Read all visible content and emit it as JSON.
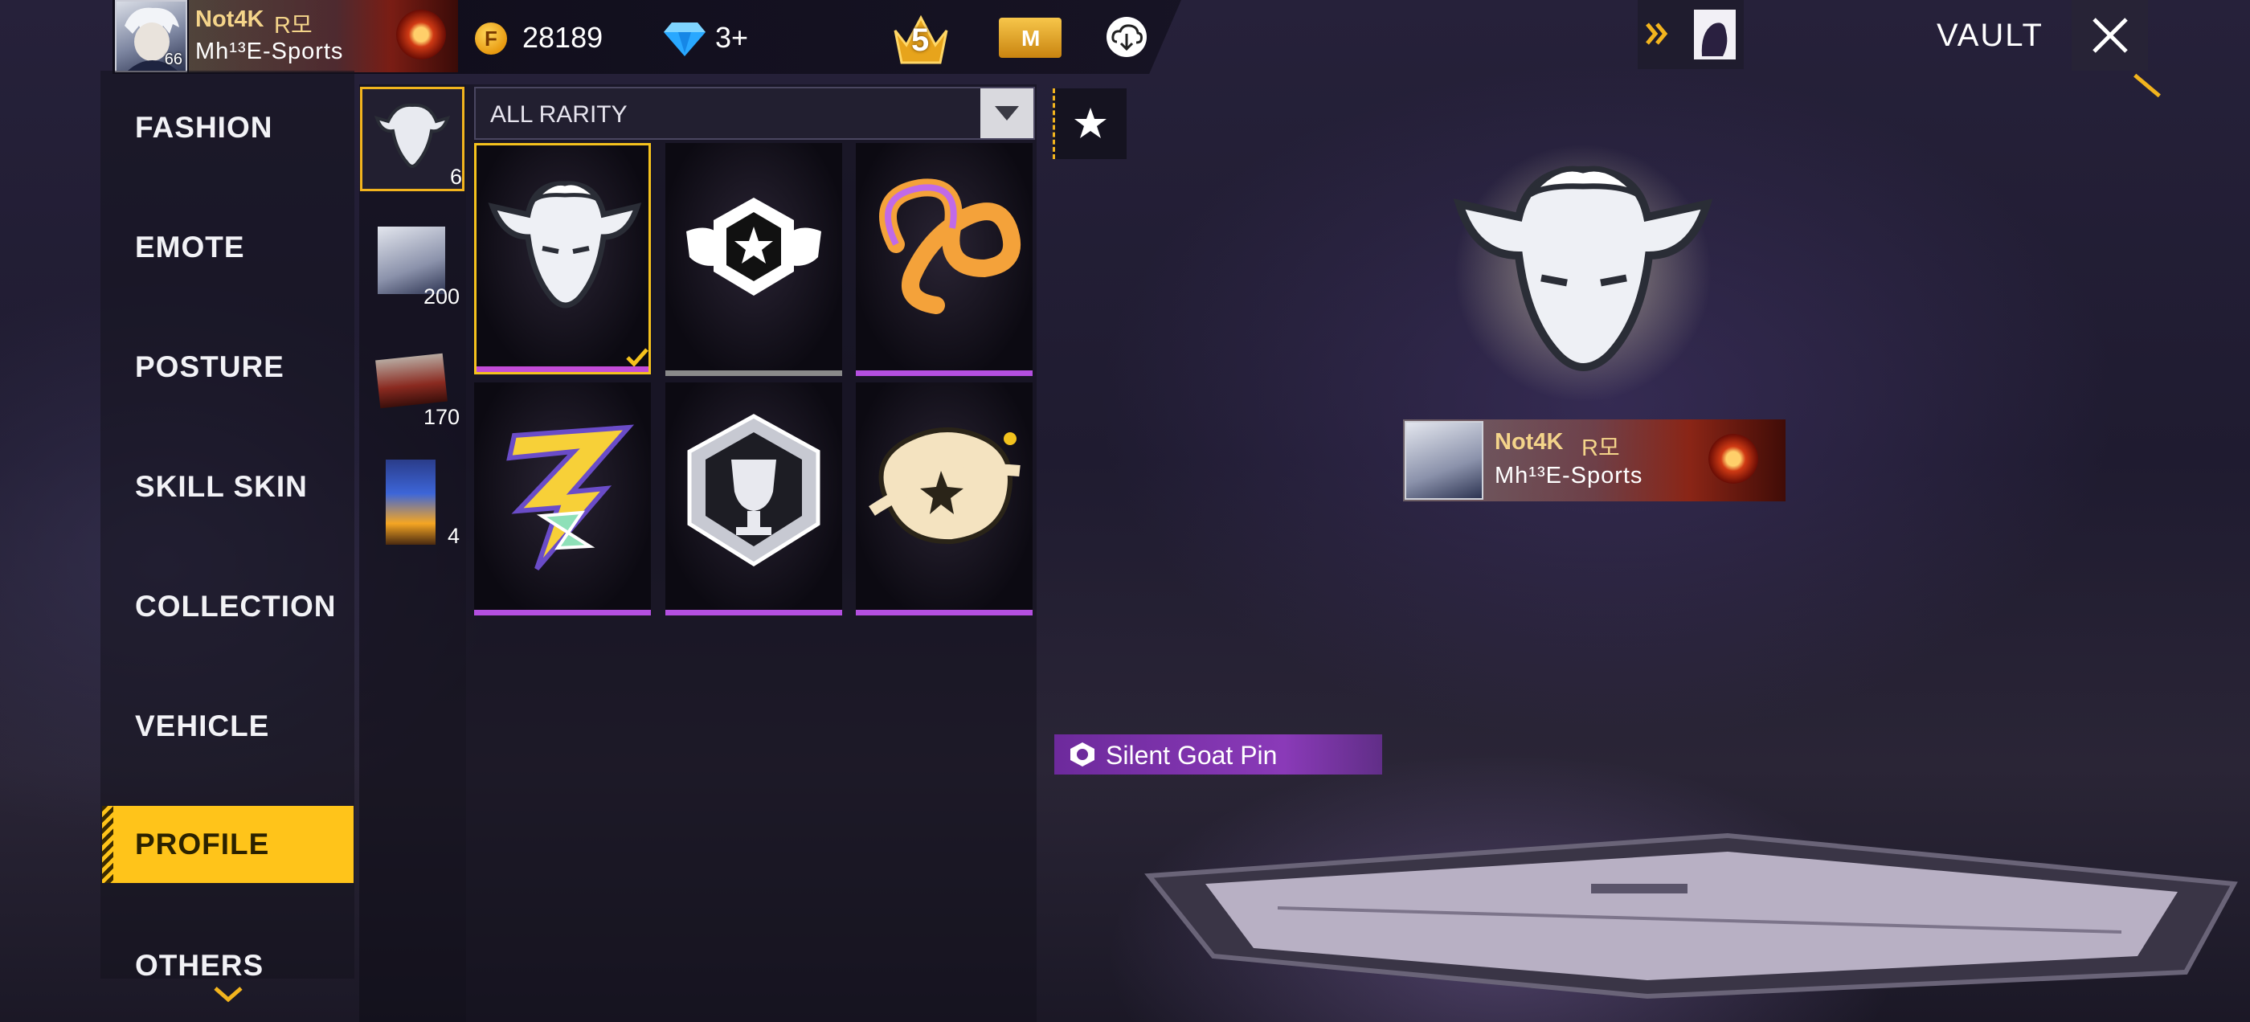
{
  "player": {
    "name": "Not4K",
    "rank_tag": "R모",
    "guild": "Mh¹³E-Sports",
    "level": "66"
  },
  "currency": {
    "gold": "28189",
    "diamonds": "3+",
    "badge_level": "5",
    "membership_badge": "M"
  },
  "header": {
    "title": "VAULT"
  },
  "categories": [
    {
      "label": "FASHION"
    },
    {
      "label": "EMOTE"
    },
    {
      "label": "POSTURE"
    },
    {
      "label": "SKILL SKIN"
    },
    {
      "label": "COLLECTION"
    },
    {
      "label": "VEHICLE"
    },
    {
      "label": "PROFILE",
      "active": true
    },
    {
      "label": "OTHERS"
    }
  ],
  "subtabs": [
    {
      "icon": "goat-pin-icon",
      "count": "6",
      "selected": true
    },
    {
      "icon": "avatar-icon",
      "count": "200"
    },
    {
      "icon": "banner-icon",
      "count": "170"
    },
    {
      "icon": "card-icon",
      "count": "4"
    }
  ],
  "filter": {
    "rarity": "ALL RARITY"
  },
  "items": [
    {
      "icon": "goat-head-icon",
      "selected": true,
      "bar_color": "#c44cd8"
    },
    {
      "icon": "star-shield-icon",
      "bar_color": "#8a8a8a"
    },
    {
      "icon": "infinity-ribbon-icon",
      "bar_color": "#b44fe0"
    },
    {
      "icon": "lightning-z-icon",
      "bar_color": "#b44fe0"
    },
    {
      "icon": "trophy-shield-icon",
      "bar_color": "#b44fe0"
    },
    {
      "icon": "planet-fist-icon",
      "bar_color": "#b44fe0"
    }
  ],
  "preview": {
    "item_name": "Silent Goat Pin",
    "item_icon": "goat-head-icon"
  },
  "colors": {
    "accent": "#ffc41a",
    "rarity_epic": "#b44fe0",
    "name_gold": "#f4d48a"
  }
}
